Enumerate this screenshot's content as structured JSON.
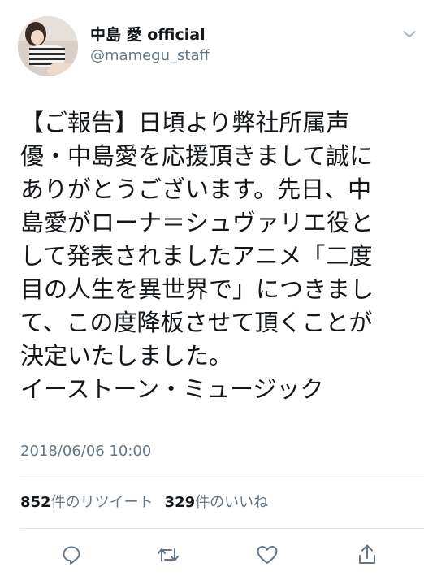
{
  "user": {
    "display_name": "中島 愛 official",
    "handle": "@mamegu_staff"
  },
  "tweet": {
    "lines": [
      "【ご報告】日頃より弊社所属声",
      "優・中島愛を応援頂きまして誠に",
      "ありがとうございます。先日、中",
      "島愛がローナ＝シュヴァリエ役と",
      "して発表されましたアニメ「二度",
      "目の人生を異世界で」につきまし",
      "て、この度降板させて頂くことが",
      "決定いたしました。",
      "イーストーン・ミュージック"
    ],
    "timestamp": "2018/06/06 10:00"
  },
  "stats": {
    "retweet_count": "852",
    "retweet_label": "件のリツイート",
    "like_count": "329",
    "like_label": "件のいいね"
  },
  "icons": {
    "caret": "chevron-down-icon",
    "reply": "reply-icon",
    "retweet": "retweet-icon",
    "like": "heart-icon",
    "share": "share-icon"
  },
  "colors": {
    "text": "#14171a",
    "secondary": "#657786",
    "divider": "#e1e8ed",
    "icon": "#657786"
  }
}
